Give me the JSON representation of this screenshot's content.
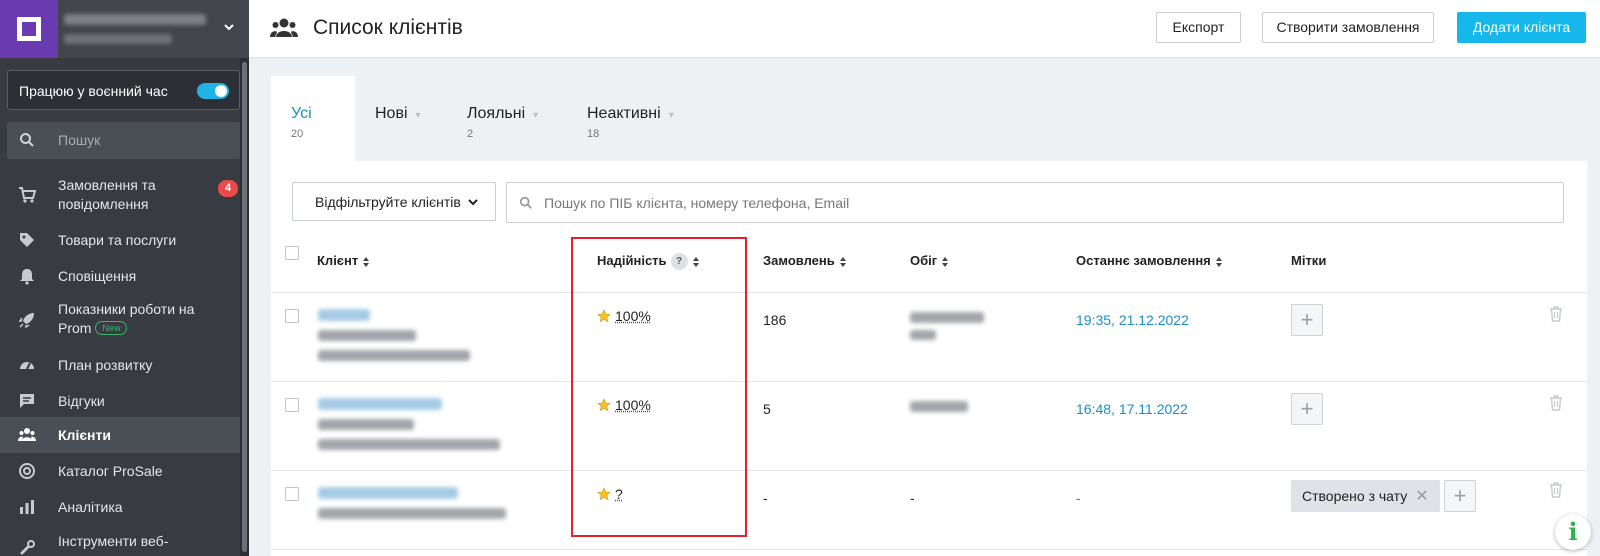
{
  "sidebar": {
    "wartime_label": "Працюю у воєнний час",
    "wartime_enabled": true,
    "search_placeholder": "Пошук",
    "items": [
      {
        "label": "Замовлення та повідомлення",
        "icon": "cart-icon",
        "badge": "4"
      },
      {
        "label": "Товари та послуги",
        "icon": "tag-icon"
      },
      {
        "label": "Сповіщення",
        "icon": "bell-icon"
      },
      {
        "label": "Показники роботи на Prom",
        "icon": "rocket-icon",
        "badge_new": "New"
      },
      {
        "label": "План розвитку",
        "icon": "gauge-icon"
      },
      {
        "label": "Відгуки",
        "icon": "comment-icon"
      },
      {
        "label": "Клієнти",
        "icon": "users-icon",
        "active": true
      },
      {
        "label": "Каталог ProSale",
        "icon": "target-icon"
      },
      {
        "label": "Аналітика",
        "icon": "bar-chart-icon"
      },
      {
        "label": "Інструменти веб-",
        "icon": "tools-icon"
      }
    ]
  },
  "header": {
    "title": "Список клієнтів",
    "export_label": "Експорт",
    "create_order_label": "Створити замовлення",
    "add_client_label": "Додати клієнта"
  },
  "tabs": [
    {
      "name": "Усі",
      "count": "20",
      "active": true
    },
    {
      "name": "Нові",
      "count": ""
    },
    {
      "name": "Лояльні",
      "count": "2"
    },
    {
      "name": "Неактивні",
      "count": "18"
    }
  ],
  "filter": {
    "label": "Відфільтруйте клієнтів",
    "search_placeholder": "Пошук по ПІБ клієнта, номеру телефона, Email"
  },
  "table": {
    "headers": {
      "client": "Клієнт",
      "reliability": "Надійність",
      "reliability_help": "?",
      "orders": "Замовлень",
      "turnover": "Обіг",
      "last_order": "Останнє замовлення",
      "tags": "Мітки"
    },
    "rows": [
      {
        "reliability": "100%",
        "orders": "186",
        "turnover": "",
        "last_order": "19:35, 21.12.2022",
        "tags": []
      },
      {
        "reliability": "100%",
        "orders": "5",
        "turnover": "",
        "last_order": "16:48, 17.11.2022",
        "tags": []
      },
      {
        "reliability": "?",
        "orders": "-",
        "turnover": "-",
        "last_order": "-",
        "tags": [
          "Створено з чату"
        ]
      }
    ]
  },
  "colors": {
    "accent": "#16b7ea",
    "link": "#1a8ecb",
    "highlight_box": "#e3212d",
    "logo": "#6a3ab0",
    "sidebar_bg": "#383c42"
  }
}
